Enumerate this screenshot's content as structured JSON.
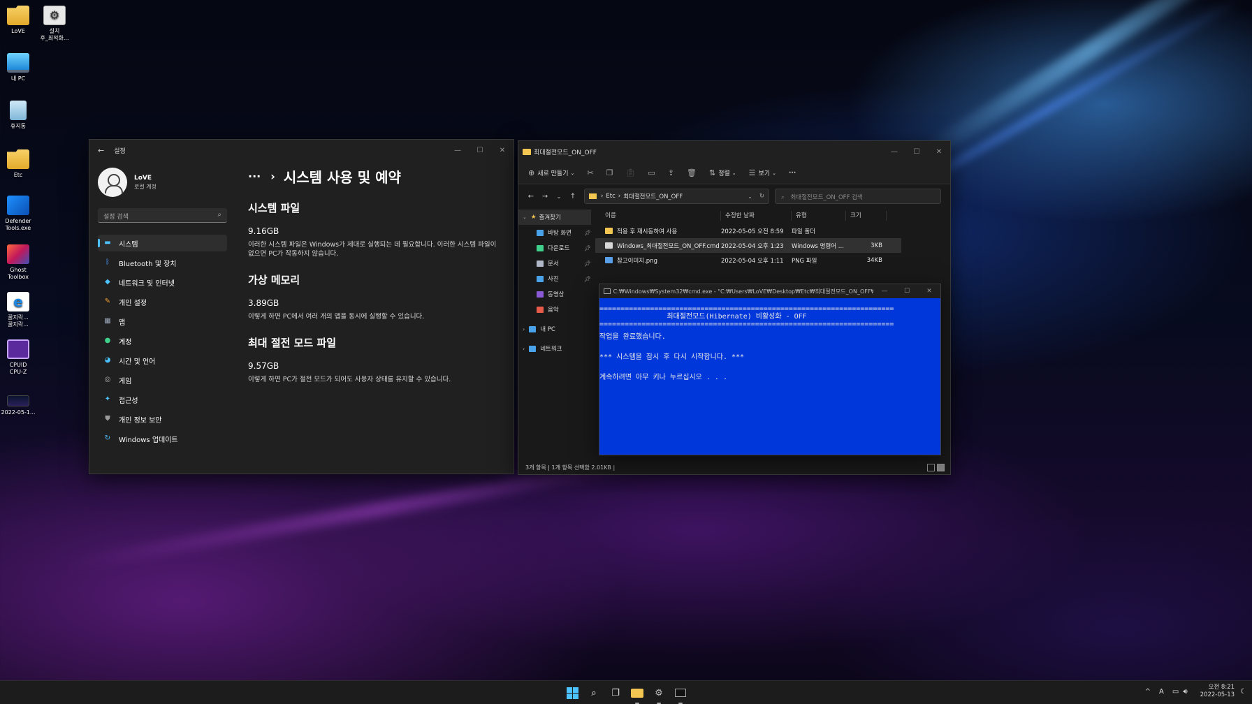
{
  "desktop": {
    "icons": [
      {
        "label": "LoVE",
        "icon": "folder-icon"
      },
      {
        "label": "설치\n후_최적화...",
        "icon": "gear-file-icon"
      },
      {
        "label": "내 PC",
        "icon": "pc-icon"
      },
      {
        "label": "휴지통",
        "icon": "recycle-bin-icon"
      },
      {
        "label": "Etc",
        "icon": "folder-icon"
      },
      {
        "label": "Defender\nTools.exe",
        "icon": "defender-icon"
      },
      {
        "label": "Ghost\nToolbox",
        "icon": "ghost-toolbox-icon"
      },
      {
        "label": "꿀지락...\n꿀지락...",
        "icon": "ie-icon"
      },
      {
        "label": "CPUID\nCPU-Z",
        "icon": "cpuz-icon"
      },
      {
        "label": "2022-05-1...",
        "icon": "image-thumbnail-icon"
      }
    ]
  },
  "settings": {
    "title": "설정",
    "profile_name": "LoVE",
    "profile_sub": "로컬 계정",
    "search_placeholder": "설정 검색",
    "nav": [
      {
        "label": "시스템",
        "icon": "monitor-icon",
        "color": "#4cc2ff",
        "active": true
      },
      {
        "label": "Bluetooth 및 장치",
        "icon": "bluetooth-icon",
        "color": "#4c9cff"
      },
      {
        "label": "네트워크 및 인터넷",
        "icon": "wifi-icon",
        "color": "#4cc2ff"
      },
      {
        "label": "개인 설정",
        "icon": "brush-icon",
        "color": "#f0a030"
      },
      {
        "label": "앱",
        "icon": "apps-icon",
        "color": "#9aa7b8"
      },
      {
        "label": "계정",
        "icon": "person-icon",
        "color": "#3fd18b"
      },
      {
        "label": "시간 및 언어",
        "icon": "globe-clock-icon",
        "color": "#4cc2ff"
      },
      {
        "label": "게임",
        "icon": "gamepad-icon",
        "color": "#b0b0b0"
      },
      {
        "label": "접근성",
        "icon": "accessibility-icon",
        "color": "#4cc2ff"
      },
      {
        "label": "개인 정보 보안",
        "icon": "shield-icon",
        "color": "#9a9a9a"
      },
      {
        "label": "Windows 업데이트",
        "icon": "update-icon",
        "color": "#4cc2ff"
      }
    ],
    "breadcrumb_dots": "···",
    "breadcrumb_sep": "›",
    "page_title": "시스템 사용 및 예약",
    "sections": [
      {
        "title": "시스템 파일",
        "size": "9.16GB",
        "desc": "이러한 시스템 파일은 Windows가 제대로 실행되는 데 필요합니다. 이러한 시스템 파일이 없으면 PC가 작동하지 않습니다."
      },
      {
        "title": "가상 메모리",
        "size": "3.89GB",
        "desc": "이렇게 하면 PC에서 여러 개의 앱을 동시에 실행할 수 있습니다."
      },
      {
        "title": "최대 절전 모드 파일",
        "size": "9.57GB",
        "desc": "이렇게 하면 PC가 절전 모드가 되어도 사용자 상태를 유지할 수 있습니다."
      }
    ]
  },
  "explorer": {
    "title": "최대절전모드_ON_OFF",
    "cmd": {
      "new_label": "새로 만들기",
      "sort_label": "정렬",
      "view_label": "보기",
      "more_label": "···"
    },
    "address": {
      "part1": "Etc",
      "sep": "›",
      "part2": "최대절전모드_ON_OFF"
    },
    "search_placeholder": "최대절전모드_ON_OFF 검색",
    "nav": {
      "quick_access": "즐겨찾기",
      "items": [
        {
          "label": "바탕 화면",
          "color": "#4aa3e8"
        },
        {
          "label": "다운로드",
          "color": "#3fd18b"
        },
        {
          "label": "문서",
          "color": "#b0b8c8"
        },
        {
          "label": "사진",
          "color": "#4aa3e8"
        },
        {
          "label": "동영상",
          "color": "#8a5ad6"
        },
        {
          "label": "음악",
          "color": "#e85a4a"
        }
      ],
      "this_pc": "내 PC",
      "network": "네트워크"
    },
    "columns": [
      "이름",
      "수정한 날짜",
      "유형",
      "크기"
    ],
    "files": [
      {
        "name": "적용 후 재시동하여 사용",
        "date": "2022-05-05 오전 8:59",
        "type": "파일 폴더",
        "size": "",
        "icon": "folder-icon",
        "color": "#f3c652",
        "selected": false
      },
      {
        "name": "Windows_최대절전모드_ON_OFF.cmd",
        "date": "2022-05-04 오후 1:23",
        "type": "Windows 명령어 ...",
        "size": "3KB",
        "icon": "cmd-file-icon",
        "color": "#d8d8d8",
        "selected": true
      },
      {
        "name": "참고이미지.png",
        "date": "2022-05-04 오후 1:11",
        "type": "PNG 파일",
        "size": "34KB",
        "icon": "image-file-icon",
        "color": "#5aa0e8",
        "selected": false
      }
    ],
    "status": "3개 항목  |  1개 항목 선택함 2.01KB  |"
  },
  "cmd_window": {
    "title": "C:₩Windows₩System32₩cmd.exe - \"C:₩Users₩LoVE₩Desktop₩Etc₩최대절전모드_ON_OFF₩Wi...",
    "lines": [
      "======================================================================",
      "                최대절전모드(Hibernate) 비활성화 - OFF",
      "======================================================================",
      "작업을 완료했습니다.",
      "",
      "*** 시스템을 잠시 후 다시 시작합니다. ***",
      "",
      "계속하려면 아무 키나 누르십시오 . . ."
    ]
  },
  "taskbar": {
    "tray_chevron": "^",
    "ime": "A",
    "time": "오전 8:21",
    "date": "2022-05-13"
  }
}
